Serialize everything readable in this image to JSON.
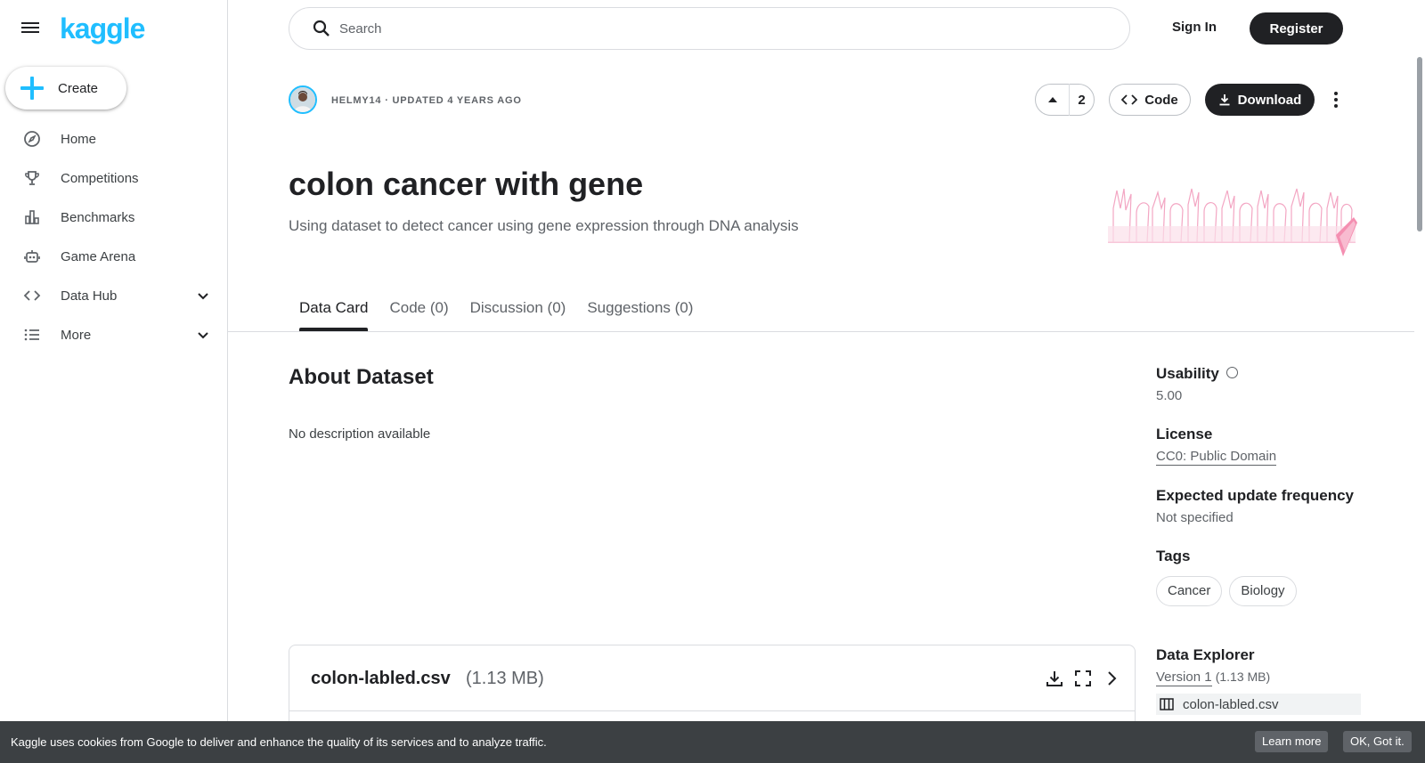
{
  "app": {
    "logo": "kaggle"
  },
  "sidebar": {
    "create_label": "Create",
    "items": [
      {
        "label": "Home",
        "icon": "compass-icon"
      },
      {
        "label": "Competitions",
        "icon": "trophy-icon"
      },
      {
        "label": "Benchmarks",
        "icon": "bar-chart-icon"
      },
      {
        "label": "Game Arena",
        "icon": "robot-icon"
      },
      {
        "label": "Data Hub",
        "icon": "code-icon"
      },
      {
        "label": "More",
        "icon": "list-icon"
      }
    ]
  },
  "header": {
    "search_placeholder": "Search",
    "signin_label": "Sign In",
    "register_label": "Register"
  },
  "dataset": {
    "byline": "HELMY14 · UPDATED 4 YEARS AGO",
    "upvotes": "2",
    "code_label": "Code",
    "download_label": "Download",
    "title": "colon cancer with gene",
    "subtitle": "Using dataset to detect cancer using gene expression through DNA analysis"
  },
  "tabs": [
    {
      "label": "Data Card",
      "active": true
    },
    {
      "label": "Code (0)",
      "active": false
    },
    {
      "label": "Discussion (0)",
      "active": false
    },
    {
      "label": "Suggestions (0)",
      "active": false
    }
  ],
  "about": {
    "heading": "About Dataset",
    "description": "No description available"
  },
  "file_card": {
    "name": "colon-labled.csv",
    "size": "(1.13 MB)"
  },
  "meta": {
    "usability_label": "Usability",
    "usability_value": "5.00",
    "license_label": "License",
    "license_value": "CC0: Public Domain",
    "update_label": "Expected update frequency",
    "update_value": "Not specified",
    "tags_label": "Tags",
    "tags": [
      "Cancer",
      "Biology"
    ],
    "explorer_label": "Data Explorer",
    "explorer_version": "Version 1",
    "explorer_size": "(1.13 MB)",
    "explorer_file": "colon-labled.csv"
  },
  "cookie": {
    "text": "Kaggle uses cookies from Google to deliver and enhance the quality of its services and to analyze traffic.",
    "learn_more": "Learn more",
    "ok": "OK, Got it."
  },
  "colors": {
    "brand": "#20beff",
    "primary_dark": "#202124",
    "ribbon": "#f48fb1"
  }
}
